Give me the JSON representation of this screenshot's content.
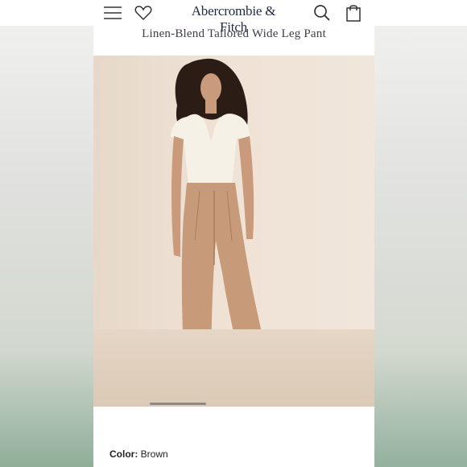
{
  "header": {
    "brand": "Abercrombie & Fitch",
    "icons": {
      "menu": "hamburger-menu-icon",
      "wishlist": "heart-icon",
      "search": "search-icon",
      "bag": "shopping-bag-icon"
    }
  },
  "product": {
    "title": "Linen-Blend Tailored Wide Leg Pant",
    "color_label": "Color:",
    "color_value": "Brown"
  },
  "colors": {
    "brand_navy": "#1f2a44",
    "pant_tan": "#c79a7a",
    "top_cream": "#f5f1e6"
  }
}
